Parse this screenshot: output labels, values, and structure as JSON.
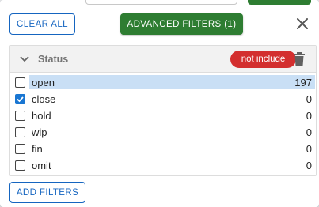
{
  "toolbar": {
    "clear_all_label": "CLEAR ALL",
    "advanced_filters_label": "ADVANCED FILTERS (1)",
    "close_icon": "close-icon"
  },
  "section": {
    "title": "Status",
    "mode_badge": "not include",
    "expand_icon": "chevron-down-icon",
    "delete_icon": "trash-icon",
    "options": [
      {
        "label": "open",
        "count": "197",
        "checked": false,
        "highlighted": true
      },
      {
        "label": "close",
        "count": "0",
        "checked": true,
        "highlighted": false
      },
      {
        "label": "hold",
        "count": "0",
        "checked": false,
        "highlighted": false
      },
      {
        "label": "wip",
        "count": "0",
        "checked": false,
        "highlighted": false
      },
      {
        "label": "fin",
        "count": "0",
        "checked": false,
        "highlighted": false
      },
      {
        "label": "omit",
        "count": "0",
        "checked": false,
        "highlighted": false
      }
    ]
  },
  "footer": {
    "add_filters_label": "ADD FILTERS"
  },
  "colors": {
    "primary": "#1565c0",
    "success": "#2e7d32",
    "danger": "#d32f2f",
    "highlight": "#c9dff5"
  }
}
